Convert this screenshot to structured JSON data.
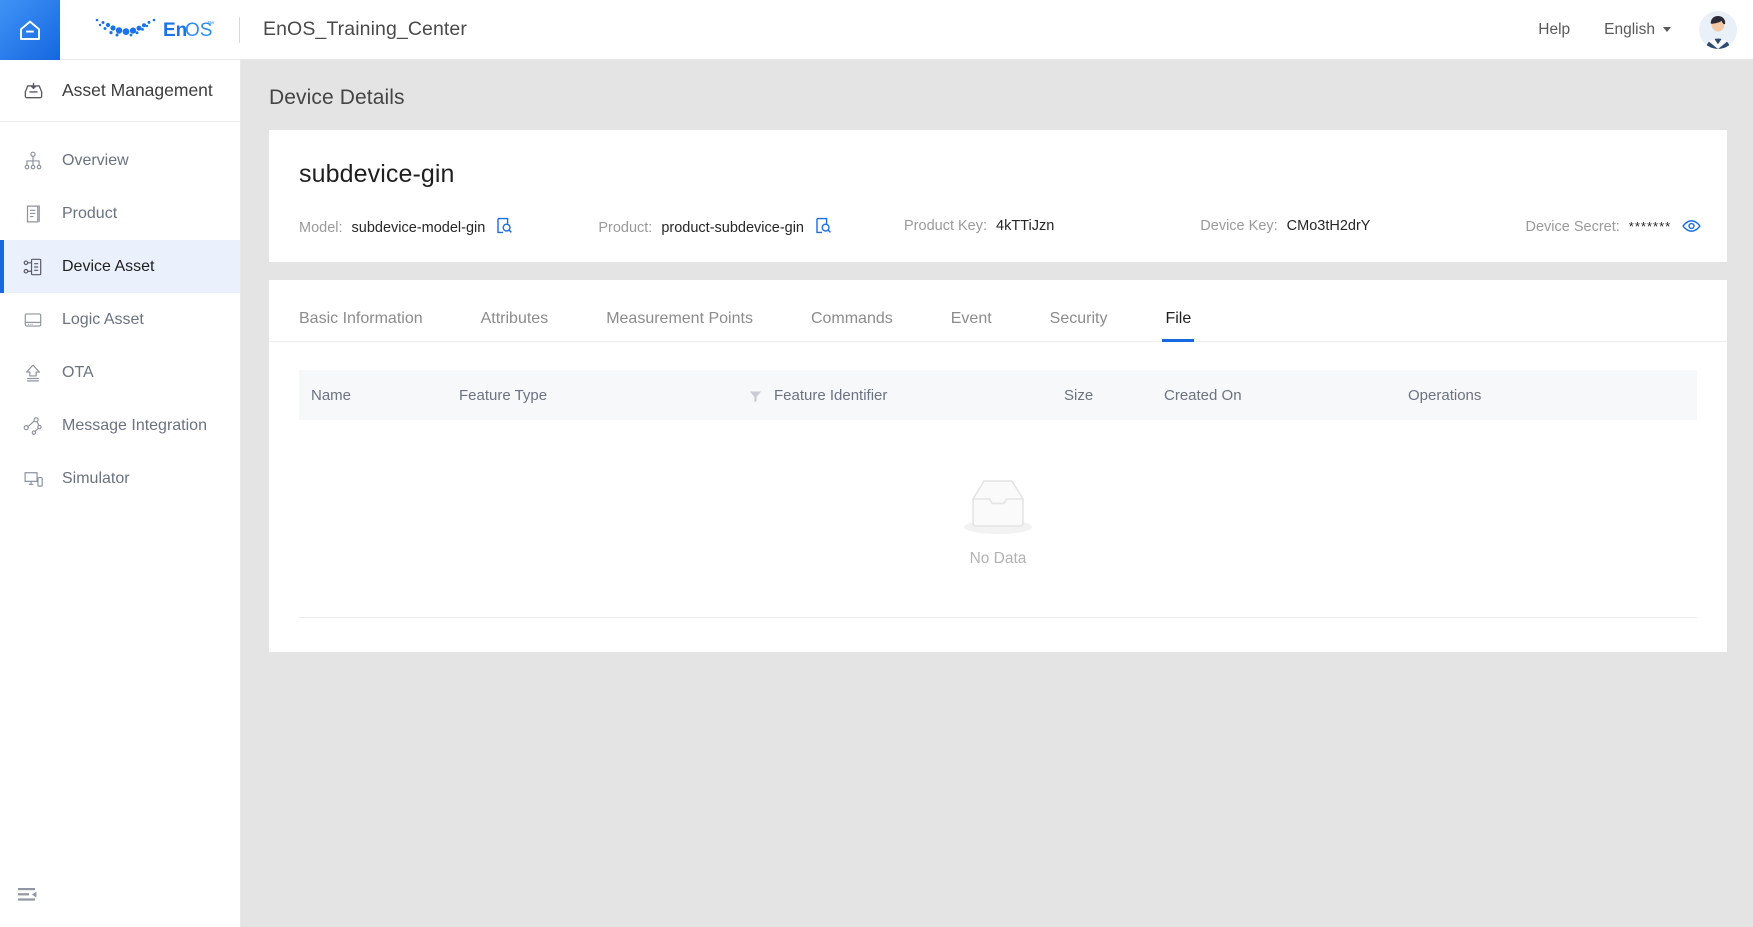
{
  "topbar": {
    "home_icon": "home-icon",
    "brand_name": "EnOS",
    "brand_tm": "™",
    "app_title": "EnOS_Training_Center",
    "help_label": "Help",
    "language_label": "English",
    "avatar_icon": "user-avatar"
  },
  "sidebar": {
    "header": {
      "label": "Asset Management",
      "icon": "inbox-download-icon"
    },
    "items": [
      {
        "label": "Overview",
        "icon": "sitemap-icon",
        "active": false
      },
      {
        "label": "Product",
        "icon": "document-icon",
        "active": false
      },
      {
        "label": "Device Asset",
        "icon": "device-node-icon",
        "active": true
      },
      {
        "label": "Logic Asset",
        "icon": "server-icon",
        "active": false
      },
      {
        "label": "OTA",
        "icon": "upload-arrow-icon",
        "active": false
      },
      {
        "label": "Message Integration",
        "icon": "share-nodes-icon",
        "active": false
      },
      {
        "label": "Simulator",
        "icon": "monitor-phone-icon",
        "active": false
      }
    ],
    "collapse_icon": "sidebar-collapse-icon"
  },
  "main": {
    "page_title": "Device Details",
    "device": {
      "name": "subdevice-gin",
      "fields": [
        {
          "key": "model",
          "label": "Model:",
          "value": "subdevice-model-gin",
          "icon": "search-document-icon"
        },
        {
          "key": "product",
          "label": "Product:",
          "value": "product-subdevice-gin",
          "icon": "search-document-icon"
        },
        {
          "key": "product_key",
          "label": "Product Key:",
          "value": "4kTTiJzn",
          "icon": ""
        },
        {
          "key": "device_key",
          "label": "Device Key:",
          "value": "CMo3tH2drY",
          "icon": ""
        },
        {
          "key": "device_secret",
          "label": "Device Secret:",
          "value": "*******",
          "icon": "eye-icon"
        }
      ]
    },
    "tabs": [
      {
        "label": "Basic Information",
        "active": false
      },
      {
        "label": "Attributes",
        "active": false
      },
      {
        "label": "Measurement Points",
        "active": false
      },
      {
        "label": "Commands",
        "active": false
      },
      {
        "label": "Event",
        "active": false
      },
      {
        "label": "Security",
        "active": false
      },
      {
        "label": "File",
        "active": true
      }
    ],
    "table": {
      "columns": [
        {
          "key": "name",
          "label": "Name",
          "filter": false
        },
        {
          "key": "feature_type",
          "label": "Feature Type",
          "filter": false
        },
        {
          "key": "feature_id",
          "label": "Feature Identifier",
          "filter": true,
          "filter_icon": "filter-icon"
        },
        {
          "key": "size",
          "label": "Size",
          "filter": false
        },
        {
          "key": "created_on",
          "label": "Created On",
          "filter": false
        },
        {
          "key": "operations",
          "label": "Operations",
          "filter": false
        }
      ],
      "rows": [],
      "empty_text": "No Data",
      "empty_icon": "empty-box-icon"
    }
  },
  "colors": {
    "accent": "#1769e0",
    "page_bg": "#e4e4e4",
    "card_bg": "#ffffff",
    "active_nav_bg": "#eaf1fd",
    "table_header_bg": "#f7f8fa",
    "muted_text": "#8c8c8c"
  }
}
